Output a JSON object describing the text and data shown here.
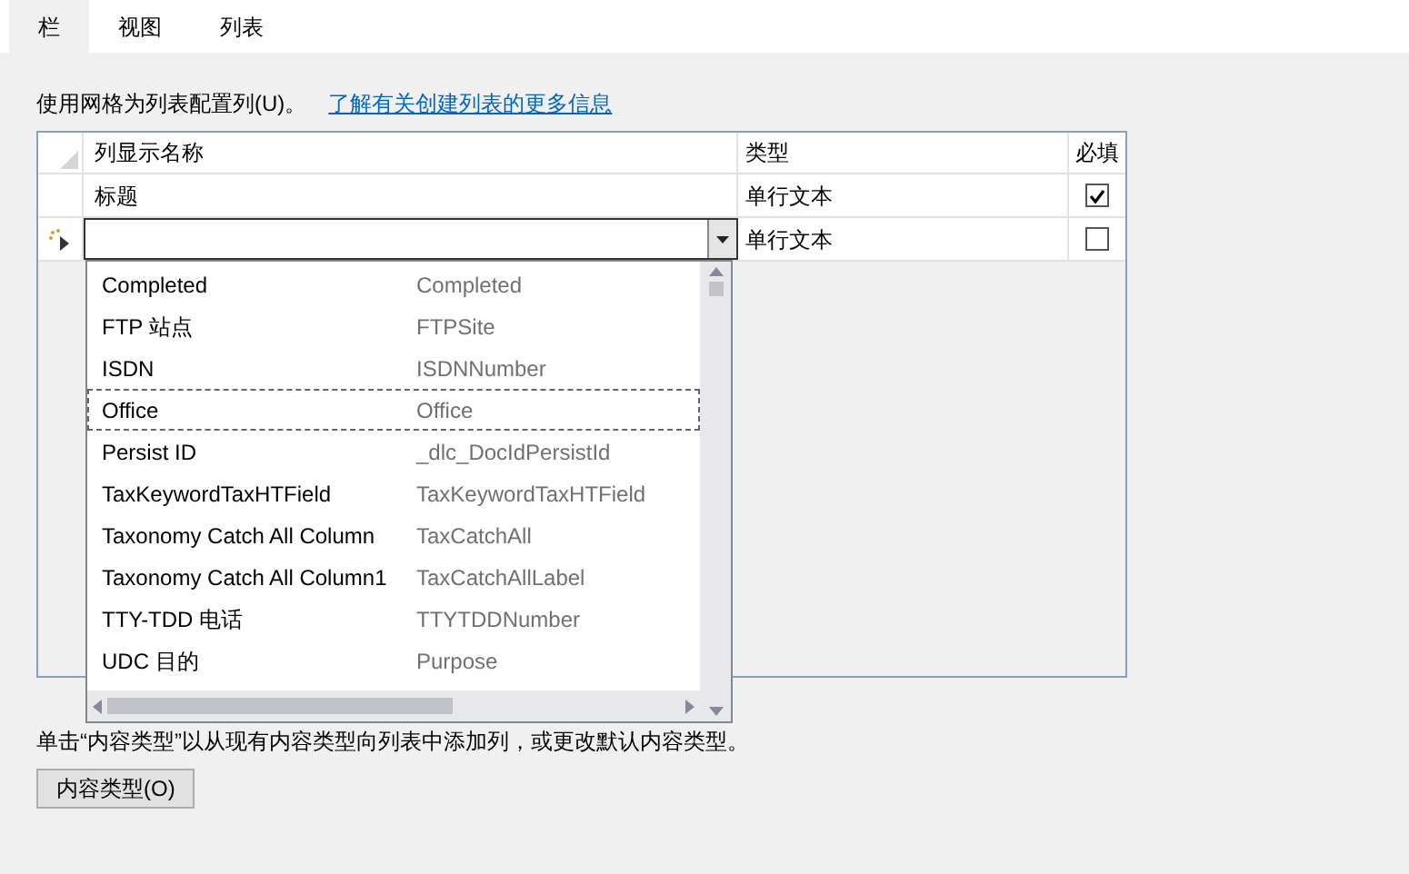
{
  "tabs": [
    {
      "label": "栏",
      "selected": true
    },
    {
      "label": "视图",
      "selected": false
    },
    {
      "label": "列表",
      "selected": false
    }
  ],
  "intro": {
    "text": "使用网格为列表配置列(U)。",
    "link": "了解有关创建列表的更多信息"
  },
  "grid": {
    "columns": [
      "列显示名称",
      "类型",
      "必填"
    ],
    "rows": [
      {
        "name": "标题",
        "type": "单行文本",
        "required": true,
        "new": false
      },
      {
        "name": "",
        "type": "单行文本",
        "required": false,
        "new": true
      }
    ]
  },
  "dropdown": {
    "items": [
      {
        "name": "Completed",
        "internal": "Completed",
        "focused": false
      },
      {
        "name": "FTP 站点",
        "internal": "FTPSite",
        "focused": false
      },
      {
        "name": "ISDN",
        "internal": "ISDNNumber",
        "focused": false
      },
      {
        "name": "Office",
        "internal": "Office",
        "focused": true
      },
      {
        "name": "Persist ID",
        "internal": "_dlc_DocIdPersistId",
        "focused": false
      },
      {
        "name": "TaxKeywordTaxHTField",
        "internal": "TaxKeywordTaxHTField",
        "focused": false
      },
      {
        "name": "Taxonomy Catch All Column",
        "internal": "TaxCatchAll",
        "focused": false
      },
      {
        "name": "Taxonomy Catch All Column1",
        "internal": "TaxCatchAllLabel",
        "focused": false
      },
      {
        "name": "TTY-TDD 电话",
        "internal": "TTYTDDNumber",
        "focused": false
      },
      {
        "name": "UDC 目的",
        "internal": "Purpose",
        "focused": false
      }
    ]
  },
  "hint": "单击“内容类型”以从现有内容类型向列表中添加列，或更改默认内容类型。",
  "button": "内容类型(O)"
}
